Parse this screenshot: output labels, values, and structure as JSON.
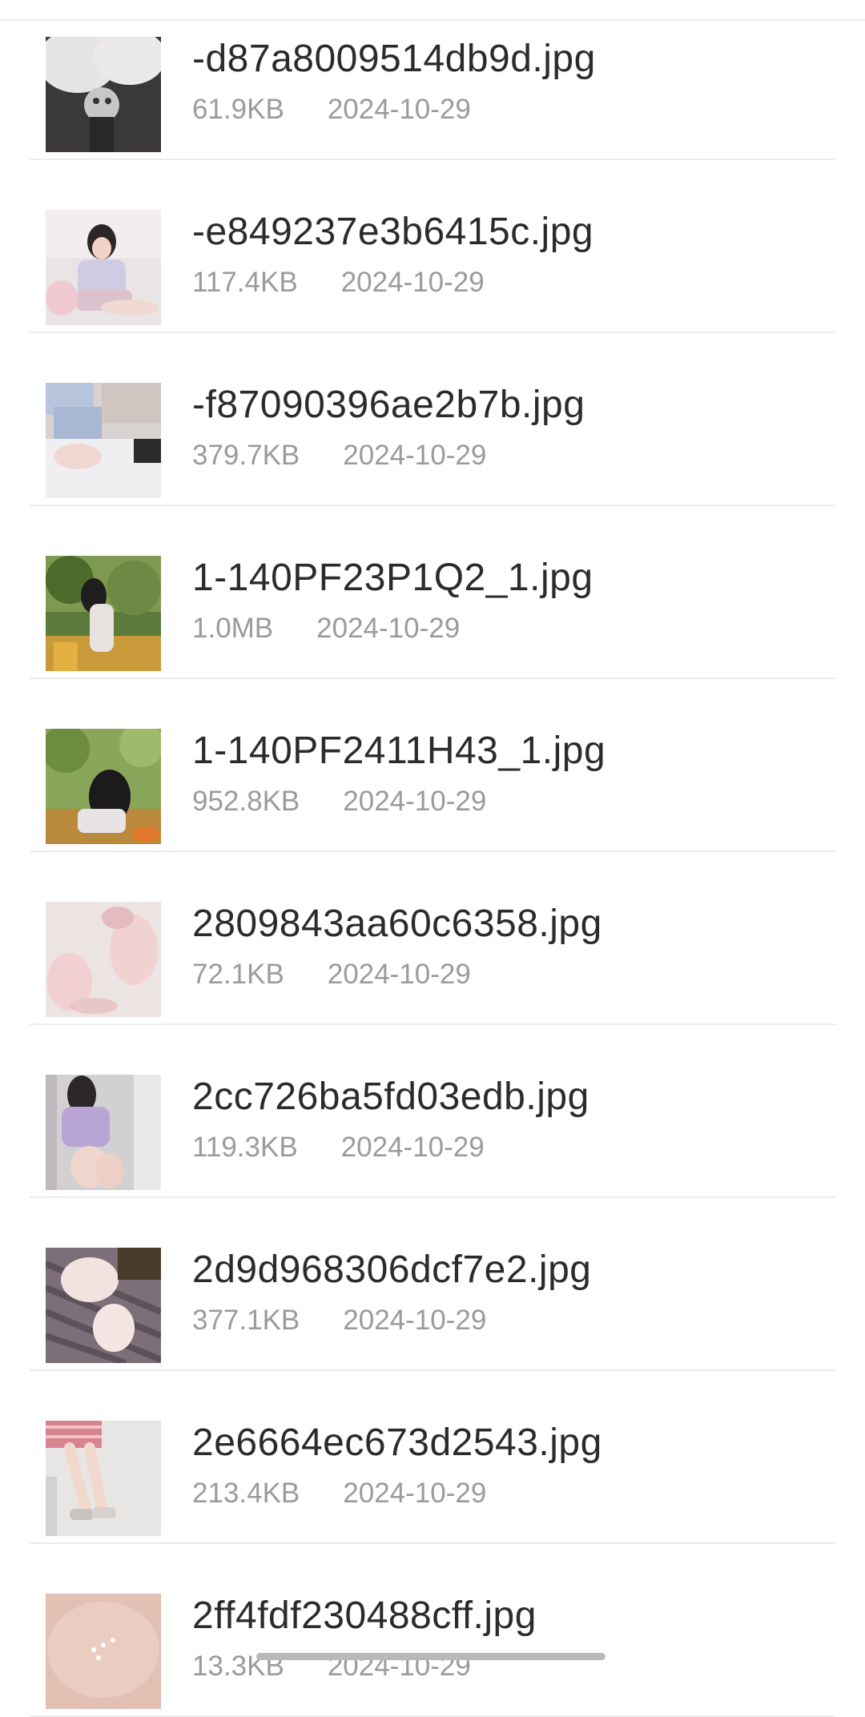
{
  "files": [
    {
      "name": "-d87a8009514db9d.jpg",
      "size": "61.9KB",
      "date": "2024-10-29",
      "thumb": "image-thumbnail-icon"
    },
    {
      "name": "-e849237e3b6415c.jpg",
      "size": "117.4KB",
      "date": "2024-10-29",
      "thumb": "image-thumbnail-icon"
    },
    {
      "name": "-f87090396ae2b7b.jpg",
      "size": "379.7KB",
      "date": "2024-10-29",
      "thumb": "image-thumbnail-icon"
    },
    {
      "name": "1-140PF23P1Q2_1.jpg",
      "size": "1.0MB",
      "date": "2024-10-29",
      "thumb": "image-thumbnail-icon"
    },
    {
      "name": "1-140PF2411H43_1.jpg",
      "size": "952.8KB",
      "date": "2024-10-29",
      "thumb": "image-thumbnail-icon"
    },
    {
      "name": "2809843aa60c6358.jpg",
      "size": "72.1KB",
      "date": "2024-10-29",
      "thumb": "image-thumbnail-icon"
    },
    {
      "name": "2cc726ba5fd03edb.jpg",
      "size": "119.3KB",
      "date": "2024-10-29",
      "thumb": "image-thumbnail-icon"
    },
    {
      "name": "2d9d968306dcf7e2.jpg",
      "size": "377.1KB",
      "date": "2024-10-29",
      "thumb": "image-thumbnail-icon"
    },
    {
      "name": "2e6664ec673d2543.jpg",
      "size": "213.4KB",
      "date": "2024-10-29",
      "thumb": "image-thumbnail-icon"
    },
    {
      "name": "2ff4fdf230488cff.jpg",
      "size": "13.3KB",
      "date": "2024-10-29",
      "thumb": "image-thumbnail-icon"
    }
  ],
  "colors": {
    "text_primary": "#2b2b2b",
    "text_secondary": "#9b9b9b",
    "divider": "#ececec",
    "background": "#ffffff"
  }
}
